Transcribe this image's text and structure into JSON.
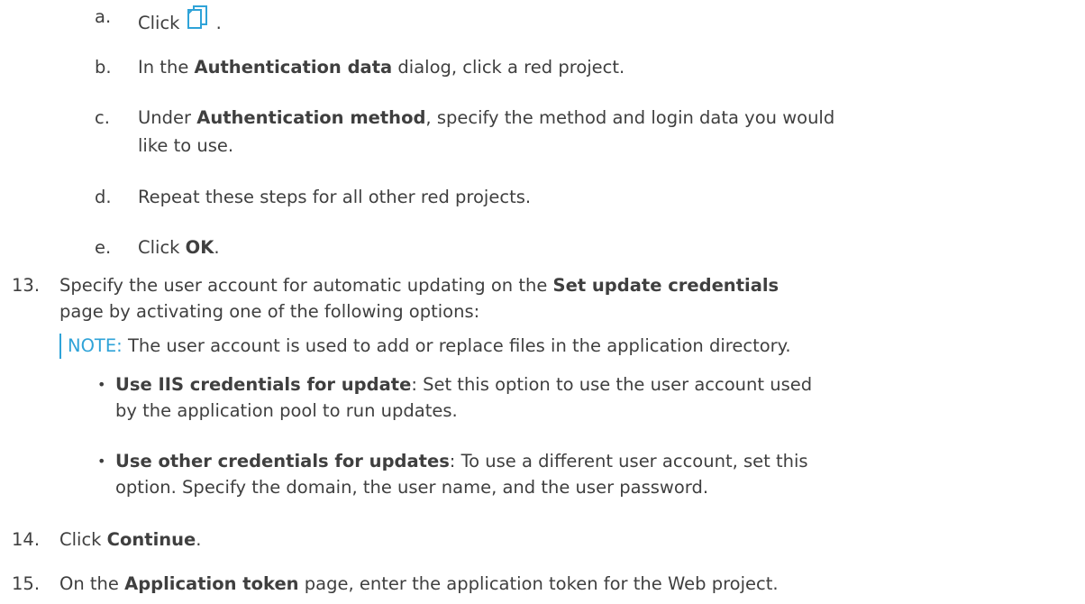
{
  "steps": {
    "a": {
      "marker": "a.",
      "text": "Click ",
      "after_icon": "."
    },
    "b": {
      "marker": "b.",
      "pre": "In the ",
      "bold": "Authentication data",
      "post": " dialog, click a red project."
    },
    "c": {
      "marker": "c.",
      "pre": "Under ",
      "bold": "Authentication method",
      "post": ", specify the method and login data you would",
      "line2": "like to use."
    },
    "d": {
      "marker": "d.",
      "text": "Repeat these steps for all other red projects."
    },
    "e": {
      "marker": "e.",
      "pre": "Click ",
      "bold": "OK",
      "post": "."
    },
    "s13": {
      "marker": "13.",
      "pre": "Specify the user account for automatic updating on the ",
      "bold": "Set update credentials",
      "line2": "page by activating one of the following options:"
    },
    "note": {
      "label": "NOTE:",
      "text": " The user account is used to add or replace files in the application directory."
    },
    "bullet1": {
      "bold": "Use IIS credentials for update",
      "post": ": Set this option to use the user account used",
      "line2": "by the application pool to run updates."
    },
    "bullet2": {
      "bold": "Use other credentials for updates",
      "post": ": To use a different user account, set this",
      "line2": "option. Specify the domain, the user name, and the user password."
    },
    "s14": {
      "marker": "14.",
      "pre": "Click ",
      "bold": "Continue",
      "post": "."
    },
    "s15": {
      "marker": "15.",
      "pre": "On the ",
      "bold": "Application token",
      "post": " page, enter the application token for the Web project."
    }
  },
  "icons": {
    "copy": "copy-document-icon",
    "accent": "#2fa3d8"
  }
}
